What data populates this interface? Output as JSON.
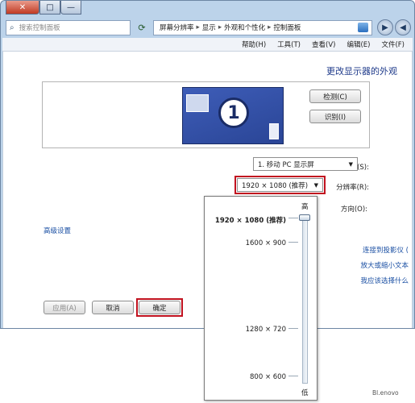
{
  "window": {
    "caption_buttons": [
      "✕",
      "□",
      "—"
    ]
  },
  "address": {
    "search_placeholder": "搜索控制面板",
    "breadcrumb": [
      "控制面板",
      "外观和个性化",
      "显示",
      "屏幕分辨率"
    ],
    "separator": "▸"
  },
  "menu": {
    "items": [
      "文件(F)",
      "编辑(E)",
      "查看(V)",
      "工具(T)",
      "帮助(H)"
    ]
  },
  "page": {
    "title": "更改显示器的外观",
    "detect_button": "检测(C)",
    "identify_button": "识别(I)",
    "monitor_number": "1",
    "display_label": "显示器(S):",
    "display_value": "1. 移动 PC 显示屏",
    "resolution_label": "分辨率(R):",
    "resolution_value": "1920 × 1080 (推荐)",
    "orientation_label": "方向(O):",
    "advanced_link": "高级设置",
    "links": [
      "连接到投影仪 (",
      "放大或缩小文本",
      "我应该选择什么"
    ],
    "ok_button": "确定",
    "cancel_button": "取消",
    "apply_button": "应用(A)"
  },
  "resolution_popup": {
    "high_label": "高",
    "low_label": "低",
    "options": [
      {
        "text": "1920 × 1080 (推荐)",
        "selected": true
      },
      {
        "text": "1600 × 900",
        "selected": false
      },
      {
        "text": "1280 × 720",
        "selected": false
      },
      {
        "text": "800 × 600",
        "selected": false
      }
    ],
    "slider_level": 1.0
  },
  "watermark": "Bl.enovo",
  "colors": {
    "highlight": "#c1121f",
    "link": "#1a4fa3",
    "title": "#1e3a8a"
  }
}
